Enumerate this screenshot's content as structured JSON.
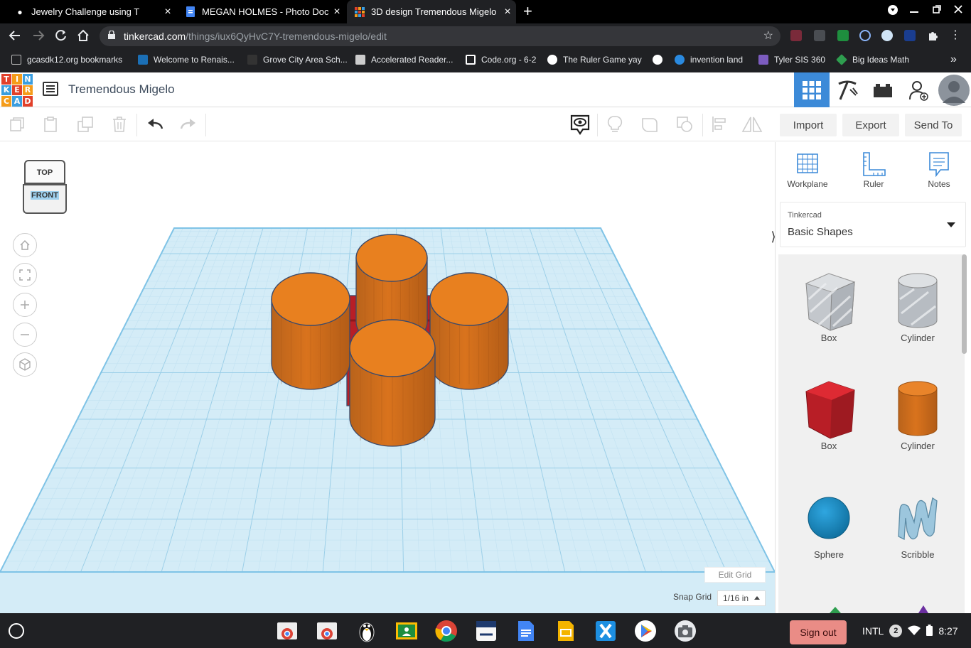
{
  "browser": {
    "tabs": [
      {
        "title": "Jewelry Challenge using T",
        "active": false
      },
      {
        "title": "MEGAN HOLMES - Photo Docum",
        "active": false
      },
      {
        "title": "3D design Tremendous Migelo |",
        "active": true
      }
    ],
    "new_tab_glyph": "+",
    "url_domain": "tinkercad.com",
    "url_path": "/things/iux6QyHvC7Y-tremendous-migelo/edit",
    "bookmarks": [
      "gcasdk12.org bookmarks",
      "Welcome to Renais...",
      "Grove City Area Sch...",
      "Accelerated Reader...",
      "Code.org - 6-2",
      "The Ruler Game yay",
      "invention land",
      "Tyler SIS 360",
      "Big Ideas Math"
    ]
  },
  "app": {
    "logo_letters": [
      "T",
      "I",
      "N",
      "K",
      "E",
      "R",
      "C",
      "A",
      "D"
    ],
    "logo_colors": [
      "#e2402a",
      "#f59c1a",
      "#3a9ee0",
      "#3a9ee0",
      "#e2402a",
      "#f59c1a",
      "#f59c1a",
      "#3a9ee0",
      "#e2402a"
    ],
    "design_title": "Tremendous Migelo",
    "accent": "#3c8ad8"
  },
  "toolbar": {
    "import_label": "Import",
    "export_label": "Export",
    "send_to_label": "Send To"
  },
  "workplane": {
    "viewcube_top": "TOP",
    "viewcube_front": "FRONT",
    "edit_grid_label": "Edit Grid",
    "snap_grid_label": "Snap Grid",
    "snap_grid_value": "1/16 in"
  },
  "panel": {
    "tools": [
      "Workplane",
      "Ruler",
      "Notes"
    ],
    "library_source": "Tinkercad",
    "library_name": "Basic Shapes",
    "shapes": [
      {
        "label": "Box",
        "variant": "hole",
        "color": "#b8bcc2"
      },
      {
        "label": "Cylinder",
        "variant": "hole",
        "color": "#b8bcc2"
      },
      {
        "label": "Box",
        "variant": "solid",
        "color": "#cc1f26"
      },
      {
        "label": "Cylinder",
        "variant": "solid",
        "color": "#e07b1d"
      },
      {
        "label": "Sphere",
        "variant": "solid",
        "color": "#1a8cc7"
      },
      {
        "label": "Scribble",
        "variant": "solid",
        "color": "#8fbcd6"
      }
    ]
  },
  "os": {
    "sign_out_label": "Sign out",
    "keyboard_layout": "INTL",
    "notification_count": "2",
    "clock": "8:27"
  }
}
